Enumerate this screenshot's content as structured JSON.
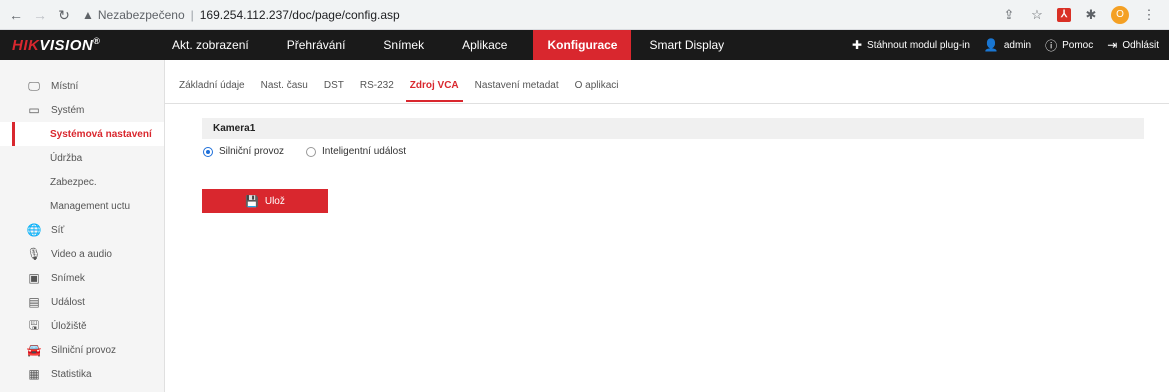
{
  "browser": {
    "insecure_label": "Nezabezpečeno",
    "url": "169.254.112.237/doc/page/config.asp",
    "ext_label": "",
    "profile_initial": "O"
  },
  "brand": {
    "hik": "HIK",
    "vision": "VISION",
    "reg": "®"
  },
  "topnav": {
    "items": [
      "Akt. zobrazení",
      "Přehrávání",
      "Snímek",
      "Aplikace",
      "Konfigurace",
      "Smart Display"
    ],
    "active_index": 4,
    "plugin": "Stáhnout modul plug-in",
    "user": "admin",
    "help": "Pomoc",
    "logout": "Odhlásit"
  },
  "sidebar": {
    "items": [
      {
        "label": "Místní",
        "icon": "monitor-icon"
      },
      {
        "label": "Systém",
        "icon": "window-icon"
      },
      {
        "label": "Systémová nastavení",
        "sub": true,
        "active": true
      },
      {
        "label": "Údržba",
        "sub": true
      },
      {
        "label": "Zabezpec.",
        "sub": true
      },
      {
        "label": "Management uctu",
        "sub": true
      },
      {
        "label": "Síť",
        "icon": "globe-icon"
      },
      {
        "label": "Video a audio",
        "icon": "audio-video-icon"
      },
      {
        "label": "Snímek",
        "icon": "image-icon"
      },
      {
        "label": "Událost",
        "icon": "calendar-icon"
      },
      {
        "label": "Úložiště",
        "icon": "storage-icon"
      },
      {
        "label": "Silniční provoz",
        "icon": "vehicle-icon"
      },
      {
        "label": "Statistika",
        "icon": "statistics-icon"
      }
    ]
  },
  "tabs": {
    "items": [
      "Základní údaje",
      "Nast. času",
      "DST",
      "RS-232",
      "Zdroj VCA",
      "Nastavení metadat",
      "O aplikaci"
    ],
    "active_index": 4
  },
  "panel": {
    "title": "Kamera1",
    "options": [
      "Silniční provoz",
      "Inteligentní událost"
    ],
    "selected_index": 0,
    "save_label": "Ulož"
  },
  "colors": {
    "accent": "#d9272e",
    "radio": "#1e6fd9"
  }
}
